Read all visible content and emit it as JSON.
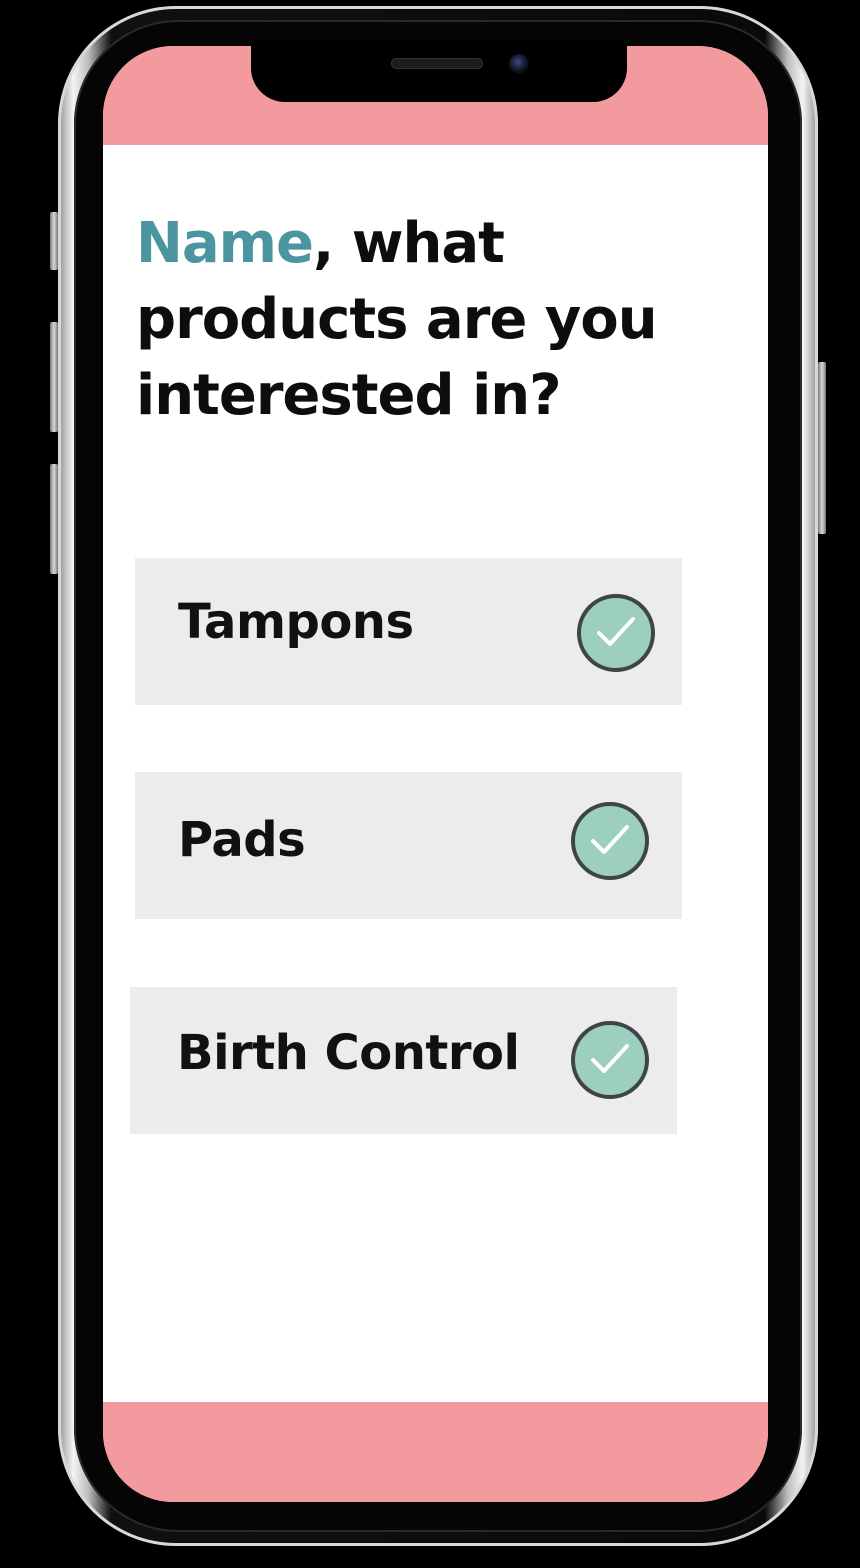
{
  "header": {
    "name_placeholder": "Name",
    "question_rest": ", what products are you interested in?"
  },
  "options": [
    {
      "label": "Tampons",
      "selected": true
    },
    {
      "label": "Pads",
      "selected": true
    },
    {
      "label": "Birth Control",
      "selected": true
    }
  ],
  "colors": {
    "accent_pink": "#f29a9d",
    "name_teal": "#4b95a0",
    "check_green": "#9ccfbd",
    "option_bg": "#ececec"
  },
  "icons": {
    "option_check": "checkmark-circle-icon"
  }
}
